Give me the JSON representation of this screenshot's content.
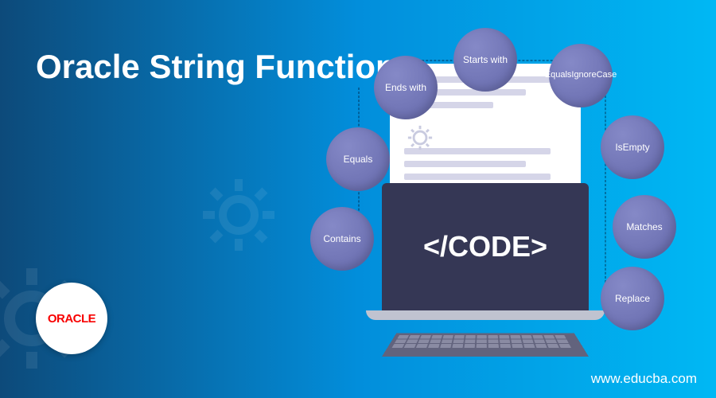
{
  "title": "Oracle String Functions",
  "logo": "ORACLE",
  "website": "www.educba.com",
  "codeLabel": "</CODE>",
  "bubbles": {
    "b1": "Starts with",
    "b2": "Ends with",
    "b3": "Equals",
    "b4": "Contains",
    "b5": "EqualsIgnoreCase",
    "b6": "IsEmpty",
    "b7": "Matches",
    "b8": "Replace"
  }
}
